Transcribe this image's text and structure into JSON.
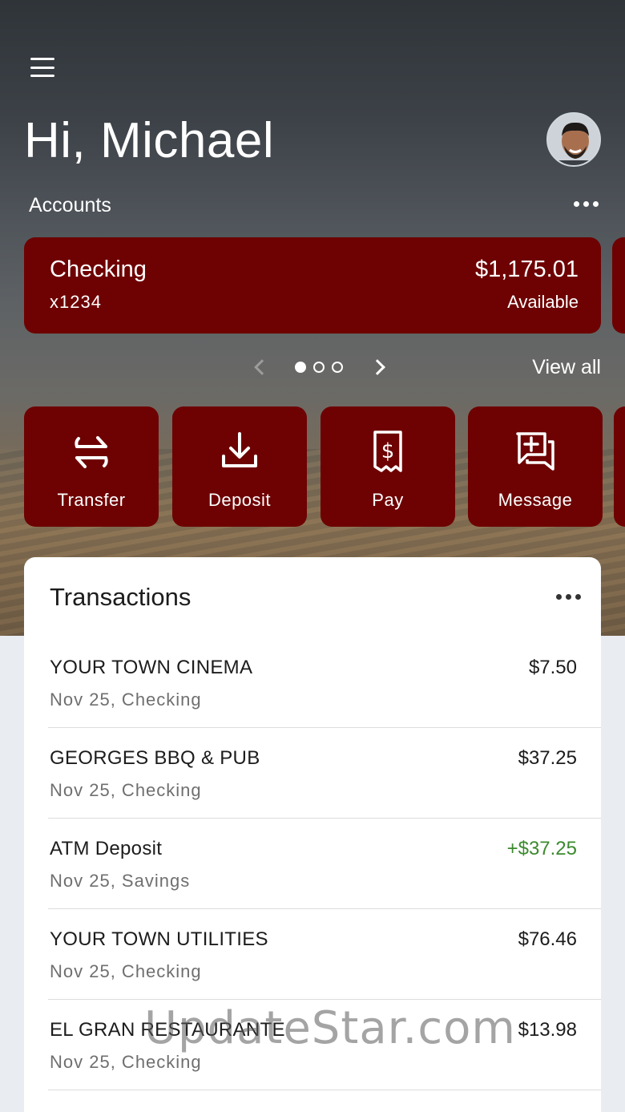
{
  "header": {
    "greeting": "Hi, Michael",
    "accounts_label": "Accounts"
  },
  "account_card": {
    "name": "Checking",
    "number": "x1234",
    "balance": "$1,175.01",
    "balance_label": "Available"
  },
  "pager": {
    "page_count": 3,
    "current_page": 1,
    "view_all_label": "View all"
  },
  "actions": [
    {
      "label": "Transfer",
      "icon": "transfer-icon"
    },
    {
      "label": "Deposit",
      "icon": "deposit-icon"
    },
    {
      "label": "Pay",
      "icon": "bill-pay-icon"
    },
    {
      "label": "Message",
      "icon": "message-icon"
    }
  ],
  "transactions": {
    "title": "Transactions",
    "items": [
      {
        "name": "YOUR TOWN CINEMA",
        "detail": "Nov 25, Checking",
        "amount": "$7.50",
        "type": "debit"
      },
      {
        "name": "GEORGES BBQ & PUB",
        "detail": "Nov 25, Checking",
        "amount": "$37.25",
        "type": "debit"
      },
      {
        "name": "ATM Deposit",
        "detail": "Nov 25, Savings",
        "amount": "+$37.25",
        "type": "credit"
      },
      {
        "name": "YOUR TOWN UTILITIES",
        "detail": "Nov 25, Checking",
        "amount": "$76.46",
        "type": "debit"
      },
      {
        "name": "EL GRAN RESTAURANTE",
        "detail": "Nov 25, Checking",
        "amount": "$13.98",
        "type": "debit"
      }
    ]
  },
  "watermark": "UpdateStar.com",
  "colors": {
    "brand": "#6e0202",
    "credit": "#3b8a2e",
    "text_primary": "#1c1c1c",
    "text_secondary": "#6f6f6f"
  }
}
